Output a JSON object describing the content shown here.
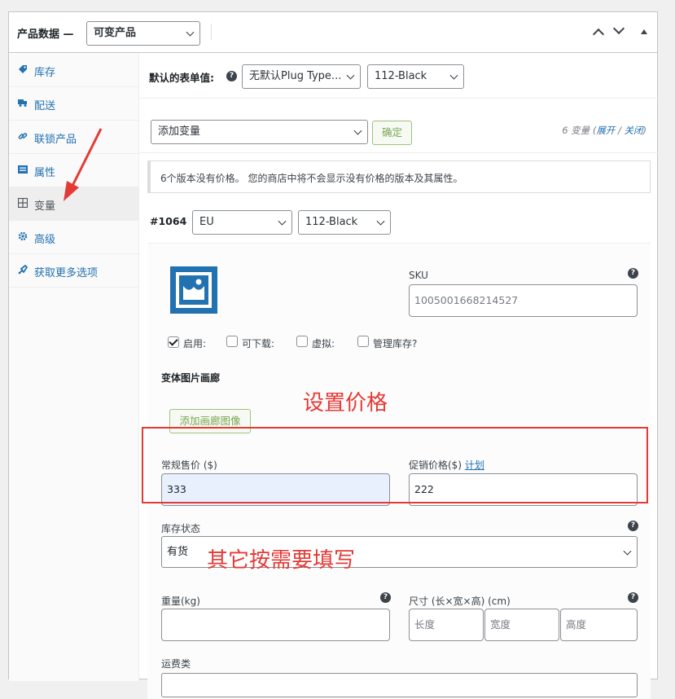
{
  "header": {
    "title": "产品数据 —",
    "product_type": "可变产品"
  },
  "sidebar": {
    "items": [
      {
        "label": "库存",
        "icon": "inventory-icon"
      },
      {
        "label": "配送",
        "icon": "truck-icon"
      },
      {
        "label": "联锁产品",
        "icon": "link-icon"
      },
      {
        "label": "属性",
        "icon": "list-icon"
      },
      {
        "label": "变量",
        "icon": "grid-icon"
      },
      {
        "label": "高级",
        "icon": "gear-icon"
      },
      {
        "label": "获取更多选项",
        "icon": "plugin-icon"
      }
    ],
    "active_index": 4
  },
  "defaults": {
    "label": "默认的表单值:",
    "attr1": "无默认Plug Type...",
    "attr2": "112-Black"
  },
  "actions": {
    "select": "添加变量",
    "confirm": "确定",
    "count_prefix": "6 变量 (",
    "expand": "展开",
    "slash": " / ",
    "close": "关闭",
    "count_suffix": ")"
  },
  "notice": "6个版本没有价格。 您的商店中将不会显示没有价格的版本及其属性。",
  "variation": {
    "number": "#1064",
    "attr1": "EU",
    "attr2": "112-Black",
    "sku_label": "SKU",
    "sku_value": "1005001668214527",
    "checkboxes": [
      {
        "label": "启用:",
        "checked": true
      },
      {
        "label": "可下载:",
        "checked": false
      },
      {
        "label": "虚拟:",
        "checked": false
      },
      {
        "label": "管理库存?",
        "checked": false
      }
    ],
    "gallery_title": "变体图片画廊",
    "gallery_button": "添加画廊图像",
    "regular_price_label": "常规售价 ($)",
    "regular_price": "333",
    "sale_price_label": "促销价格($)",
    "schedule": "计划",
    "sale_price": "222",
    "stock_status_label": "库存状态",
    "stock_status": "有货",
    "weight_label": "重量(kg)",
    "dimensions_label": "尺寸 (长×宽×高) (cm)",
    "length_ph": "长度",
    "width_ph": "宽度",
    "height_ph": "高度",
    "shipping_class_label": "运费类"
  },
  "annotations": {
    "set_price": "设置价格",
    "fill_others": "其它按需要填写"
  },
  "colors": {
    "link": "#2271b1",
    "annotation": "#e53935",
    "confirm_green": "#7ca654"
  }
}
